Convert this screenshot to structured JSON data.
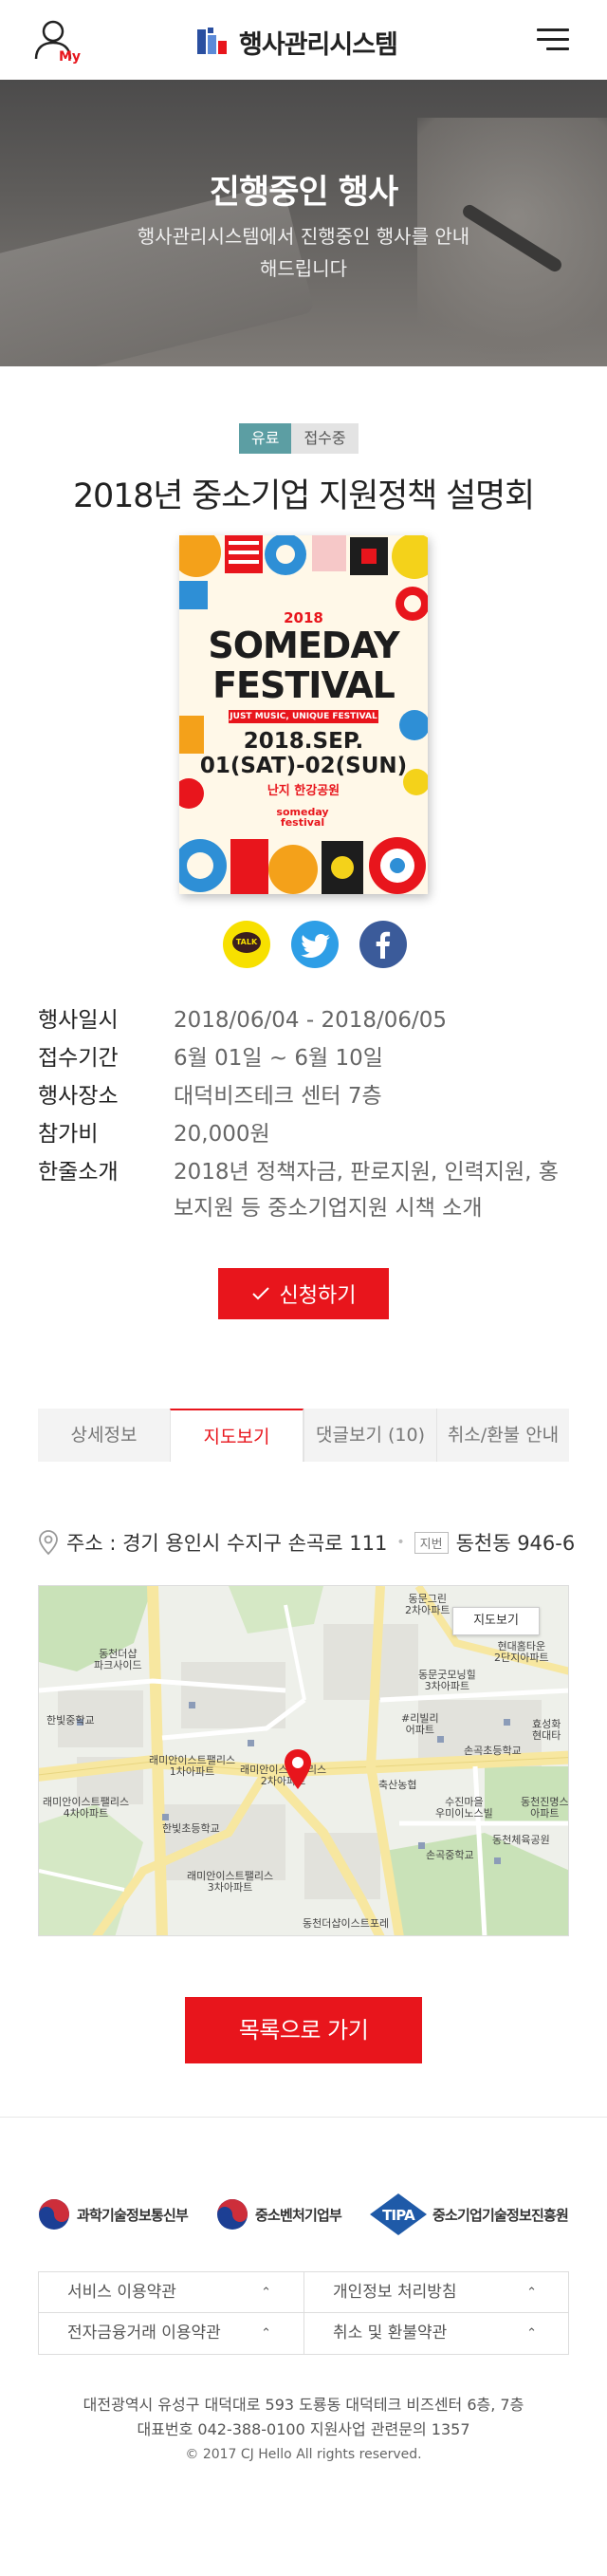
{
  "header": {
    "my_label": "My",
    "logo_text": "행사관리시스템"
  },
  "hero": {
    "title": "진행중인 행사",
    "subtitle": "행사관리시스템에서 진행중인 행사를 안내해드립니다"
  },
  "event": {
    "badge_type": "유료",
    "badge_status": "접수중",
    "title": "2018년 중소기업 지원정책 설명회",
    "poster": {
      "year": "2018",
      "line1": "SOMEDAY",
      "line2": "FESTIVAL",
      "band": "JUST MUSIC, UNIQUE FESTIVAL",
      "date1": "2018.SEP.",
      "date2": "01(SAT)-02(SUN)",
      "place": "난지 한강공원",
      "brand": "someday festival"
    },
    "share": {
      "kakao_label": "TALK"
    },
    "info": [
      {
        "label": "행사일시",
        "value": "2018/06/04 - 2018/06/05"
      },
      {
        "label": "접수기간",
        "value": "6월 01일 ~ 6월 10일"
      },
      {
        "label": "행사장소",
        "value": "대덕비즈테크 센터 7층"
      },
      {
        "label": "참가비",
        "value": "20,000원"
      },
      {
        "label": "한줄소개",
        "value": "2018년 정책자금, 판로지원, 인력지원, 홍보지원 등 중소기업지원 시책 소개"
      }
    ],
    "apply_label": "신청하기"
  },
  "tabs": [
    {
      "label": "상세정보"
    },
    {
      "label": "지도보기"
    },
    {
      "label": "댓글보기 (10)"
    },
    {
      "label": "취소/환불 안내"
    }
  ],
  "address": {
    "road": "주소 : 경기 용인시 수지구 손곡로 111",
    "tag": "지번",
    "lot": "동천동 946-6"
  },
  "map": {
    "view_button": "지도보기",
    "labels": [
      "동문그린\n2차아파트",
      "현대홈타운\n2단지아파트",
      "동천더샵\n파크사이드",
      "동문굿모닝힐\n3차아파트",
      "한빛중학교",
      "#리빌리\n어파트",
      "효성화\n현대타",
      "손곡초등학교",
      "래미안이스트팰리스\n1차아파트",
      "래미안이스트팰리스\n2차아파트",
      "축산농협",
      "수진마을\n우미이노스빌",
      "동천진명스\n아파트",
      "래미안이스트팰리스\n4차아파트",
      "한빛초등학교",
      "손곡중학교",
      "동천체육공원",
      "래미안이스트팰리스\n3차아파트",
      "동천더샵이스트포레"
    ]
  },
  "list_button": "목록으로 가기",
  "footer": {
    "orgs": [
      "과학기술정보통신부",
      "중소벤처기업부",
      "중소기업기술정보진흥원"
    ],
    "tipa_mark": "TIPA",
    "links": [
      "서비스 이용약관",
      "개인정보 처리방침",
      "전자금융거래 이용약관",
      "취소 및 환불약관"
    ],
    "address_line": "대전광역시 유성구 대덕대로 593 도룡동 대덕테크 비즈센터 6층, 7층",
    "phone_line": "대표번호 042-388-0100  지원사업 관련문의 1357",
    "copyright": "© 2017 CJ Hello All rights reserved."
  },
  "colors": {
    "accent": "#e8151c",
    "badge_paid": "#5c9ea3",
    "kakao": "#f7e000",
    "twitter": "#2e9ee6",
    "facebook": "#3b5b9a"
  }
}
